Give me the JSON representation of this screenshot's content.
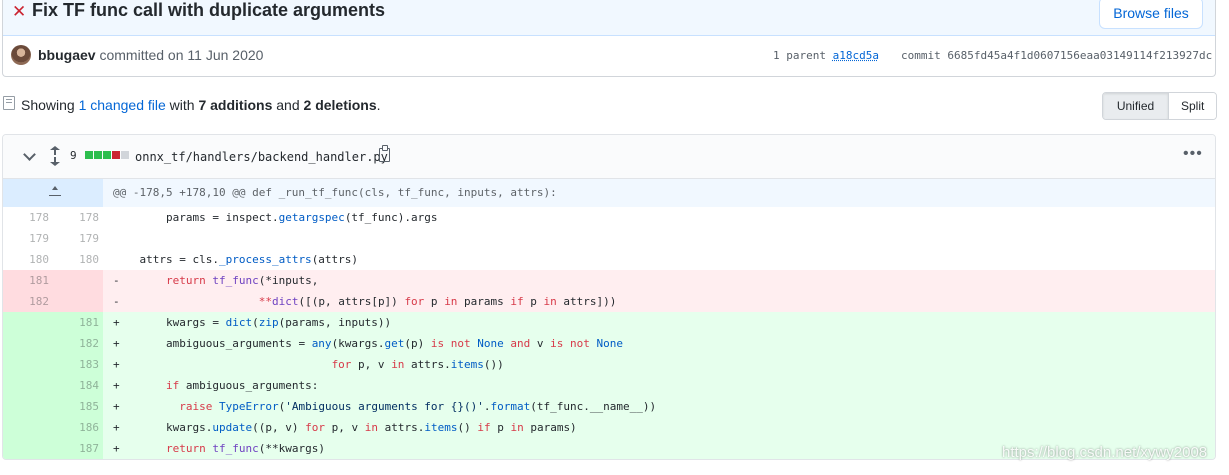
{
  "commit": {
    "status_icon": "x-icon",
    "title": "Fix TF func call with duplicate arguments",
    "browse_label": "Browse files",
    "author": "bbugaev",
    "committed_text": "committed on 11 Jun 2020",
    "parent_label": "1 parent",
    "parent_sha": "a18cd5a",
    "commit_label": "commit",
    "commit_sha": "6685fd45a4f1d0607156eaa03149114f213927dc"
  },
  "toc": {
    "showing": "Showing",
    "changed_files": "1 changed file",
    "with": "with",
    "additions": "7 additions",
    "and": "and",
    "deletions": "2 deletions",
    "period": "."
  },
  "view": {
    "unified": "Unified",
    "split": "Split"
  },
  "file": {
    "diff_count": "9",
    "diffstat_colors": [
      "#2cbe4e",
      "#2cbe4e",
      "#2cbe4e",
      "#cb2431",
      "#d1d5da"
    ],
    "path": "onnx_tf/handlers/backend_handler.py",
    "hunk": "@@ -178,5 +178,10 @@ def _run_tf_func(cls, tf_func, inputs, attrs):"
  },
  "lines": [
    {
      "type": "ctx",
      "old": "178",
      "new": "178"
    },
    {
      "type": "ctx",
      "old": "179",
      "new": "179"
    },
    {
      "type": "ctx",
      "old": "180",
      "new": "180"
    },
    {
      "type": "del",
      "old": "181",
      "new": ""
    },
    {
      "type": "del",
      "old": "182",
      "new": ""
    },
    {
      "type": "add",
      "old": "",
      "new": "181"
    },
    {
      "type": "add",
      "old": "",
      "new": "182"
    },
    {
      "type": "add",
      "old": "",
      "new": "183"
    },
    {
      "type": "add",
      "old": "",
      "new": "184"
    },
    {
      "type": "add",
      "old": "",
      "new": "185"
    },
    {
      "type": "add",
      "old": "",
      "new": "186"
    },
    {
      "type": "add",
      "old": "",
      "new": "187"
    }
  ],
  "code": {
    "l178": {
      "a": "        params = inspect.",
      "b": "getargspec",
      "c": "(tf_func).args"
    },
    "l180": {
      "a": "    attrs = cls.",
      "b": "_process_attrs",
      "c": "(attrs)"
    },
    "d181": {
      "m": "-",
      "ind": "    ",
      "kw": "return",
      "sp": " ",
      "fn": "tf_func",
      "rest": "(*inputs,"
    },
    "d182": {
      "m": "-",
      "ind": "                  ",
      "op": "**",
      "fn": "dict",
      "a": "([(p, attrs[p]) ",
      "k1": "for",
      "b": " p ",
      "k2": "in",
      "c": " params ",
      "k3": "if",
      "d": " p ",
      "k4": "in",
      "e": " attrs]))"
    },
    "a181": {
      "m": "+",
      "a": "    kwargs = ",
      "fn": "dict",
      "b": "(",
      "fn2": "zip",
      "c": "(params, inputs))"
    },
    "a182": {
      "m": "+",
      "a": "    ambiguous_arguments = ",
      "fn": "any",
      "b": "(kwargs.",
      "fn2": "get",
      "c": "(p) ",
      "k1": "is not",
      "sp1": " ",
      "c1": "None",
      "sp2": " ",
      "k2": "and",
      "d": " v ",
      "k3": "is not",
      "sp3": " ",
      "c2": "None"
    },
    "a183": {
      "m": "+",
      "ind": "                             ",
      "k1": "for",
      "a": " p, v ",
      "k2": "in",
      "b": " attrs.",
      "fn": "items",
      "c": "())"
    },
    "a184": {
      "m": "+",
      "ind": "    ",
      "k1": "if",
      "a": " ambiguous_arguments:"
    },
    "a185": {
      "m": "+",
      "ind": "      ",
      "k1": "raise",
      "sp": " ",
      "fn": "TypeError",
      "a": "(",
      "s": "'Ambiguous arguments for {}()'",
      "b": ".",
      "fn2": "format",
      "c": "(tf_func.__name__))"
    },
    "a186": {
      "m": "+",
      "a": "    kwargs.",
      "fn": "update",
      "b": "((p, v) ",
      "k1": "for",
      "c": " p, v ",
      "k2": "in",
      "d": " attrs.",
      "fn2": "items",
      "e": "() ",
      "k3": "if",
      "f": " p ",
      "k4": "in",
      "g": " params)"
    },
    "a187": {
      "m": "+",
      "ind": "    ",
      "k1": "return",
      "sp": " ",
      "fn": "tf_func",
      "a": "(**kwargs)"
    }
  },
  "watermark": "https://blog.csdn.net/xywy2008"
}
